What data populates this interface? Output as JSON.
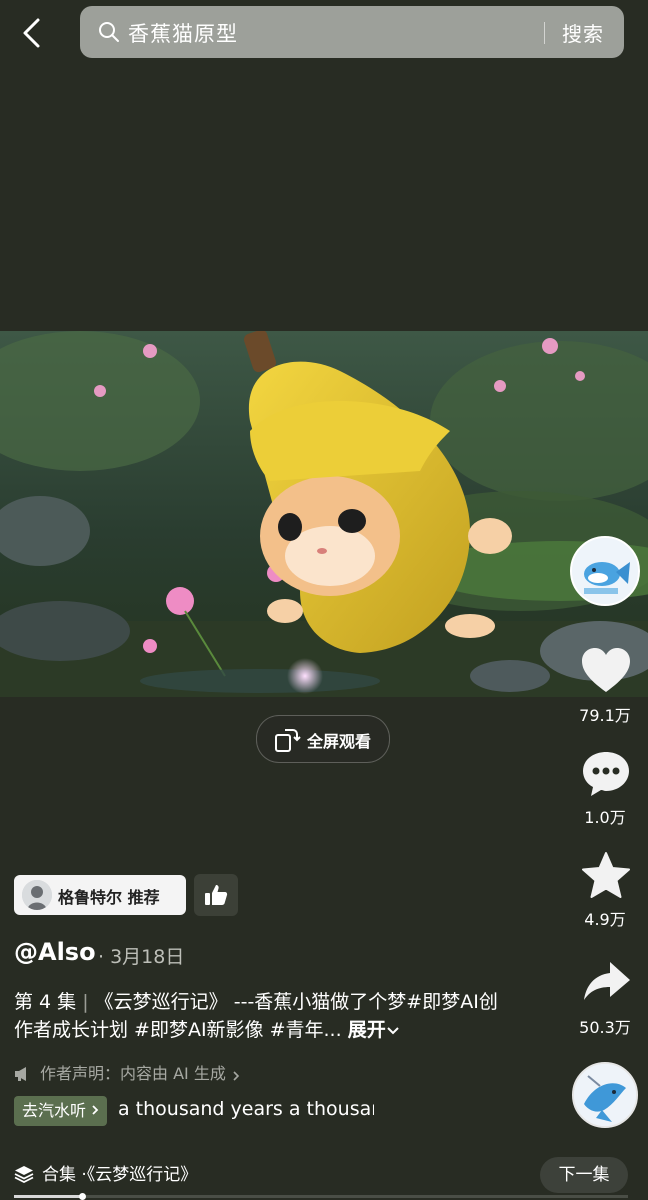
{
  "top_bar": {
    "search_query": "香蕉猫原型",
    "search_button": "搜索"
  },
  "video": {
    "fullscreen_label": "全屏观看",
    "progress": 0.11
  },
  "actions": {
    "likes": "79.1万",
    "comments": "1.0万",
    "favorites": "4.9万",
    "shares": "50.3万"
  },
  "recommend": {
    "label": "格鲁特尔  推荐"
  },
  "post": {
    "author": "@Also",
    "date": "· 3月18日",
    "episode": "第 4 集",
    "series_title": "《云梦巡行记》",
    "desc_text": "---香蕉小猫做了个梦#即梦AI创作者成长计划 #即梦AI新影像 #青年...",
    "expand_label": "展开",
    "declaration": "作者声明：内容由 AI 生成",
    "song_tag": "去汽水听",
    "song_name": "a thousand years    a thousand years"
  },
  "collection": {
    "label": "合集 ·《云梦巡行记》",
    "next_button": "下一集"
  }
}
